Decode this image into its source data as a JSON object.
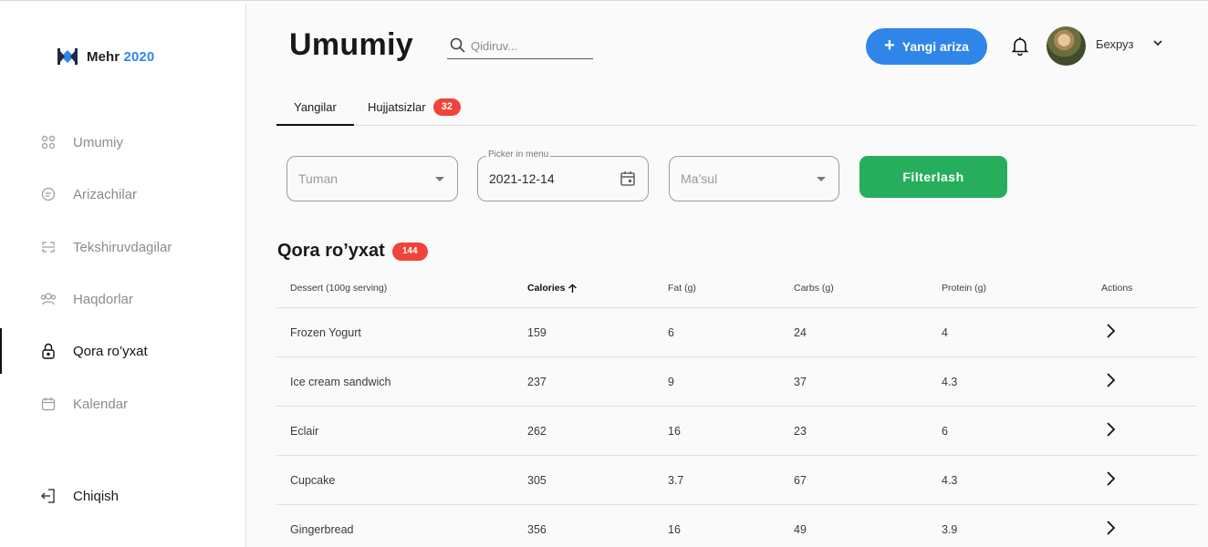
{
  "brand": {
    "name": "Mehr",
    "year": "2020"
  },
  "sidebar": {
    "items": [
      {
        "label": "Umumiy",
        "icon": "grid-icon"
      },
      {
        "label": "Arizachilar",
        "icon": "document-icon"
      },
      {
        "label": "Tekshiruvdagilar",
        "icon": "scan-icon"
      },
      {
        "label": "Haqdorlar",
        "icon": "users-icon"
      },
      {
        "label": "Qora ro’yxat",
        "icon": "lock-icon",
        "active": true
      },
      {
        "label": "Kalendar",
        "icon": "calendar-icon"
      }
    ],
    "logout_label": "Chiqish"
  },
  "header": {
    "title": "Umumiy",
    "search_placeholder": "Qidiruv...",
    "new_button_label": "Yangi ariza",
    "user_name": "Бехруз"
  },
  "tabs": [
    {
      "label": "Yangilar",
      "active": true
    },
    {
      "label": "Hujjatsizlar",
      "badge": "32"
    }
  ],
  "filters": {
    "tuman_placeholder": "Tuman",
    "date_legend": "Picker in menu",
    "date_value": "2021-12-14",
    "masul_placeholder": "Ma’sul",
    "button_label": "Filterlash"
  },
  "section": {
    "title": "Qora ro’yxat",
    "badge": "144"
  },
  "table": {
    "headers": [
      "Dessert (100g serving)",
      "Calories",
      "Fat (g)",
      "Carbs (g)",
      "Protein (g)",
      "Actions"
    ],
    "sorted_column": "Calories",
    "rows": [
      [
        "Frozen Yogurt",
        "159",
        "6",
        "24",
        "4"
      ],
      [
        "Ice cream sandwich",
        "237",
        "9",
        "37",
        "4.3"
      ],
      [
        "Eclair",
        "262",
        "16",
        "23",
        "6"
      ],
      [
        "Cupcake",
        "305",
        "3.7",
        "67",
        "4.3"
      ],
      [
        "Gingerbread",
        "356",
        "16",
        "49",
        "3.9"
      ]
    ]
  },
  "colors": {
    "accent": "#2f86e8",
    "success": "#27ae5c",
    "badge": "#f0433a"
  }
}
